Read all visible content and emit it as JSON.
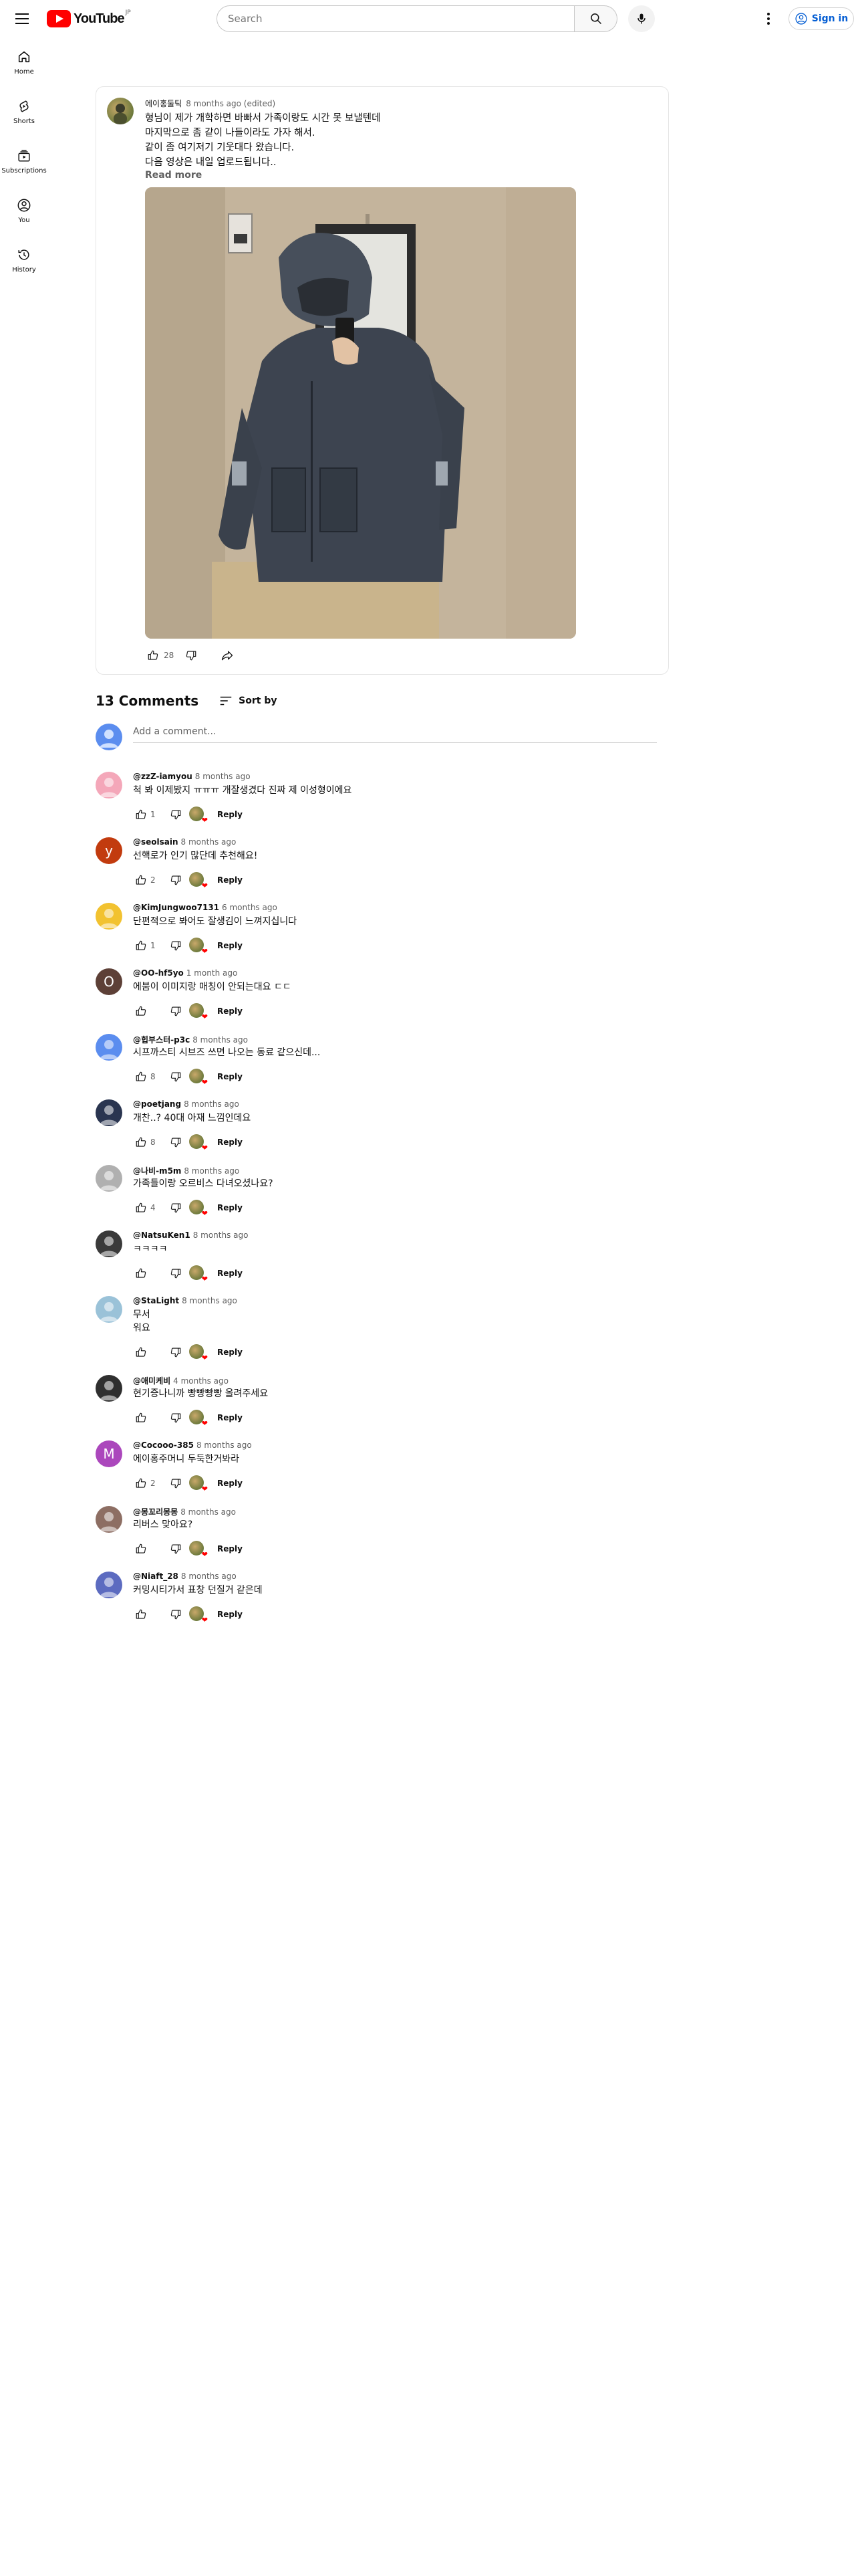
{
  "header": {
    "logo_text": "YouTube",
    "logo_country": "JP",
    "search_placeholder": "Search",
    "signin_label": "Sign in"
  },
  "sidebar": {
    "items": [
      {
        "label": "Home",
        "icon": "home-icon"
      },
      {
        "label": "Shorts",
        "icon": "shorts-icon"
      },
      {
        "label": "Subscriptions",
        "icon": "subscriptions-icon"
      },
      {
        "label": "You",
        "icon": "you-icon"
      },
      {
        "label": "History",
        "icon": "history-icon"
      }
    ]
  },
  "post": {
    "author": "에이홍둘틱",
    "time": "8 months ago (edited)",
    "text": "형님이 제가 개학하면 바빠서 가족이랑도 시간 못 보낼텐데\n마지막으로 좀 같이 나들이라도 가자 해서.\n같이 좀 여기저기 기웃대다 왔습니다.\n다음 영상은 내일 업로드됩니다..",
    "read_more": "Read more",
    "likes": "28"
  },
  "comments_section": {
    "count_label": "13 Comments",
    "sort_label": "Sort by",
    "add_placeholder": "Add a comment...",
    "reply_label": "Reply",
    "heart_color": "#ff0000"
  },
  "comments": [
    {
      "author": "@zzZ-iamyou",
      "time": "8 months ago",
      "text": "척 봐 이제봤지 ㅠㅠㅠ 개잘생겼다 진짜 제 이성형이에요",
      "likes": "1",
      "avatar_color": "#f4a7b9"
    },
    {
      "author": "@seolsain",
      "time": "8 months ago",
      "text": "선핵로가 인기 많단데 추천해요!",
      "likes": "2",
      "avatar_color": "#c23b0e",
      "avatar_letter": "y"
    },
    {
      "author": "@KimJungwoo7131",
      "time": "6 months ago",
      "text": "단편적으로 봐어도 잘생김이 느껴지십니다",
      "likes": "1",
      "avatar_color": "#f2c230"
    },
    {
      "author": "@OO-hf5yo",
      "time": "1 month ago",
      "text": "에붐이 이미지랑 매칭이 안되는대요 ㄷㄷ",
      "likes": "",
      "avatar_color": "#5d4037",
      "avatar_letter": "O"
    },
    {
      "author": "@힙부스터-p3c",
      "time": "8 months ago",
      "text": "시프까스티 시브즈 쓰면 나오는 동료 같으신데...",
      "likes": "8",
      "avatar_color": "#5b8def"
    },
    {
      "author": "@poetjang",
      "time": "8 months ago",
      "text": "개찬..? 40대 아재 느낌인데요",
      "likes": "8",
      "avatar_color": "#2a3550"
    },
    {
      "author": "@나비-m5m",
      "time": "8 months ago",
      "text": "가족들이랑 오르비스 다녀오셨나요?",
      "likes": "4",
      "avatar_color": "#b0b0b0"
    },
    {
      "author": "@NatsuKen1",
      "time": "8 months ago",
      "text": "ㅋㅋㅋㅋ",
      "likes": "",
      "avatar_color": "#3a3a3a"
    },
    {
      "author": "@StaLight",
      "time": "8 months ago",
      "text": "무서\n워요",
      "likes": "",
      "avatar_color": "#9ac2d8"
    },
    {
      "author": "@애미케비",
      "time": "4 months ago",
      "text": "현기증나니까 빵빵빵빵 올려주세요",
      "likes": "",
      "avatar_color": "#2f2f2f"
    },
    {
      "author": "@Cocooo-385",
      "time": "8 months ago",
      "text": "에이홍주머니 두둑한거봐라",
      "likes": "2",
      "avatar_color": "#ab47bc",
      "avatar_letter": "M"
    },
    {
      "author": "@몽꼬리몽몽",
      "time": "8 months ago",
      "text": "리버스 맞아요?",
      "likes": "",
      "avatar_color": "#8d6e63"
    },
    {
      "author": "@Niaft_28",
      "time": "8 months ago",
      "text": "커밍시티가서 표창 던질거 같은데",
      "likes": "",
      "avatar_color": "#5c6bc0"
    }
  ]
}
